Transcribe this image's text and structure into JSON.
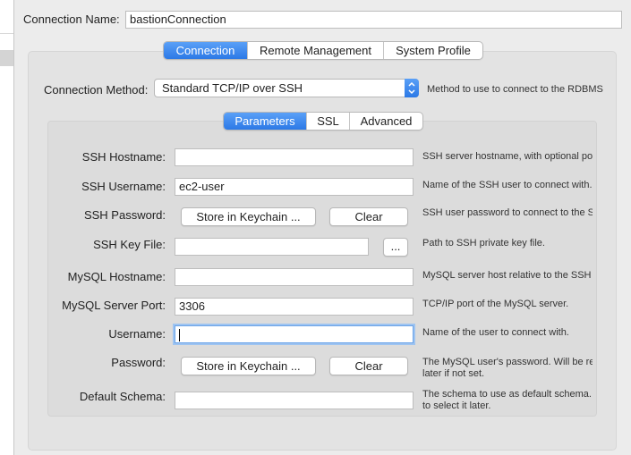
{
  "connection_name": {
    "label": "Connection Name:",
    "value": "bastionConnection"
  },
  "top_tabs": [
    {
      "label": "Connection",
      "active": true
    },
    {
      "label": "Remote Management",
      "active": false
    },
    {
      "label": "System Profile",
      "active": false
    }
  ],
  "connection_method": {
    "label": "Connection Method:",
    "value": "Standard TCP/IP over SSH",
    "description": "Method to use to connect to the RDBMS"
  },
  "sub_tabs": [
    {
      "label": "Parameters",
      "active": true
    },
    {
      "label": "SSL",
      "active": false
    },
    {
      "label": "Advanced",
      "active": false
    }
  ],
  "fields": {
    "ssh_hostname": {
      "label": "SSH Hostname:",
      "value": "",
      "description": "SSH server hostname, with  optional po"
    },
    "ssh_username": {
      "label": "SSH Username:",
      "value": "ec2-user",
      "description": "Name of the SSH user to connect with."
    },
    "ssh_password": {
      "label": "SSH Password:",
      "store_label": "Store in Keychain ...",
      "clear_label": "Clear",
      "description": "SSH user password to connect to the S"
    },
    "ssh_key_file": {
      "label": "SSH Key File:",
      "value": "",
      "browse_label": "...",
      "description": "Path to SSH private key file."
    },
    "mysql_hostname": {
      "label": "MySQL Hostname:",
      "value": "",
      "description": "MySQL server host relative to the SSH s"
    },
    "mysql_port": {
      "label": "MySQL Server Port:",
      "value": "3306",
      "description": "TCP/IP port of the MySQL server."
    },
    "username": {
      "label": "Username:",
      "value": "",
      "description": "Name of the user to connect with."
    },
    "password": {
      "label": "Password:",
      "store_label": "Store in Keychain ...",
      "clear_label": "Clear",
      "description_line1": "The MySQL user's password. Will be re",
      "description_line2": "later if not set."
    },
    "default_schema": {
      "label": "Default Schema:",
      "value": "",
      "description_line1": "The schema to use as default schema.",
      "description_line2": "to select it later."
    }
  },
  "colors": {
    "accent": "#2c79e6",
    "focus_ring": "#9ec4f1"
  },
  "icons": {
    "method_stepper": "up-down-chevron-icon"
  }
}
